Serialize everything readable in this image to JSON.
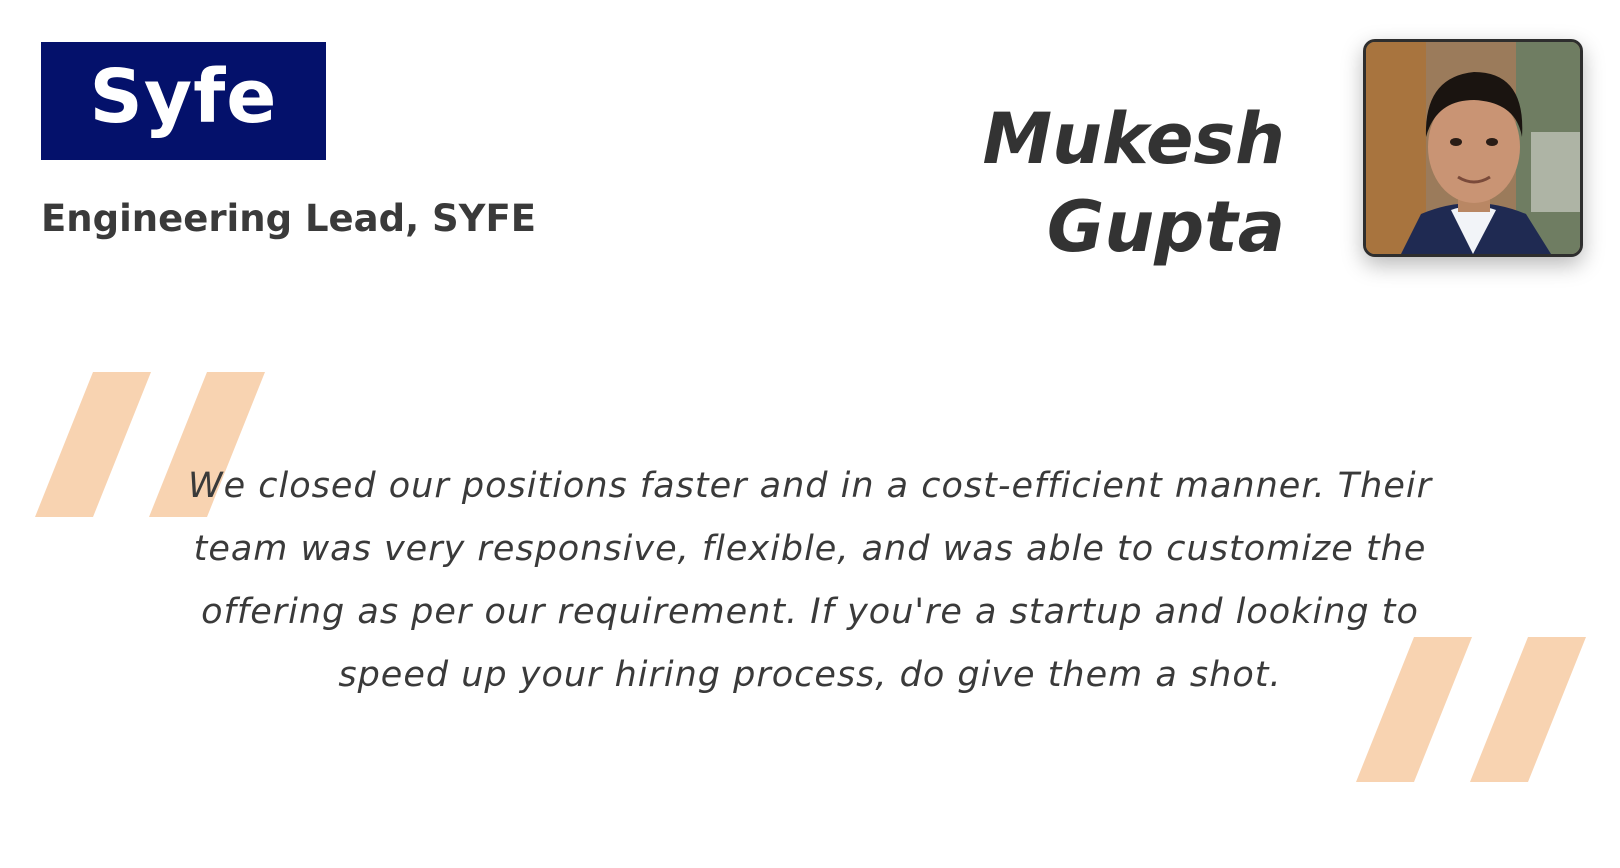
{
  "logo": {
    "text": "Syfe",
    "background_color": "#04116b"
  },
  "person": {
    "role": "Engineering Lead, SYFE",
    "first_name": "Mukesh",
    "last_name": "Gupta"
  },
  "testimonial": {
    "quote": "We closed our positions faster and in a cost-efficient manner. Their team was very responsive, flexible, and was able to customize the offering as per our requirement. If you're a startup and looking to speed up your hiring process, do give them a shot."
  },
  "colors": {
    "quote_mark": "#f8d3b1",
    "text": "#3a3a3a"
  }
}
